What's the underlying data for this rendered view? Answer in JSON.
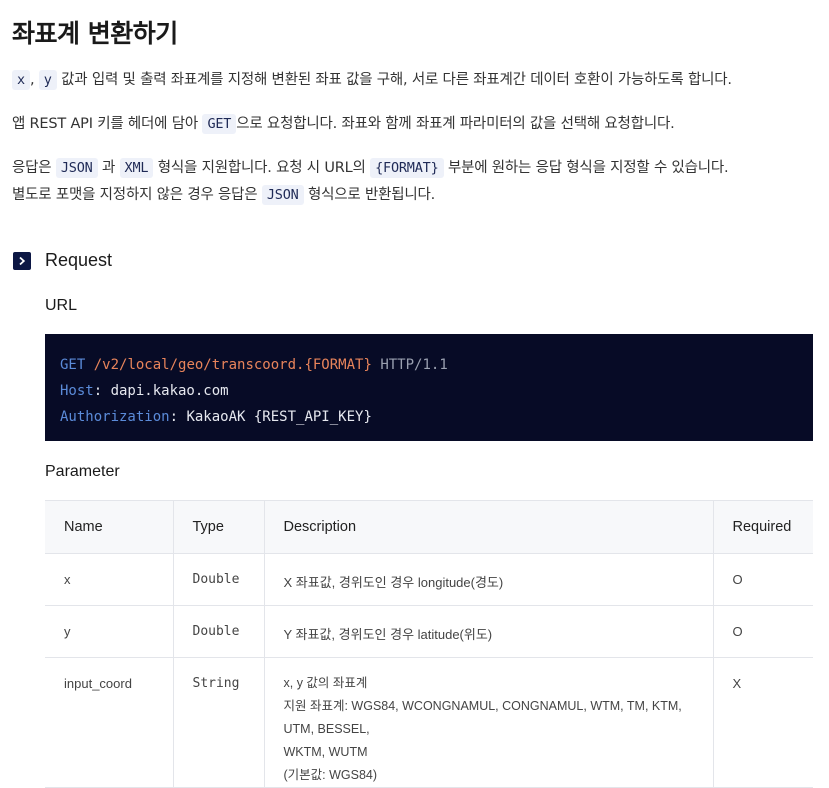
{
  "title": "좌표계 변환하기",
  "intro": {
    "x_code": "x",
    "comma": ",",
    "y_code": "y",
    "text": "값과 입력 및 출력 좌표계를 지정해 변환된 좌표 값을 구해, 서로 다른 좌표계간 데이터 호환이 가능하도록 합니다."
  },
  "auth": {
    "prefix": "앱 REST API 키를 헤더에 담아",
    "method_code": "GET",
    "suffix": "으로 요청합니다. 좌표와 함께 좌표계 파라미터의 값을 선택해 요청합니다."
  },
  "response": {
    "prefix": "응답은",
    "json_code": "JSON",
    "and": "과",
    "xml_code": "XML",
    "mid": "형식을 지원합니다. 요청 시 URL의",
    "format_code": "{FORMAT}",
    "suffix": "부분에 원하는 응답 형식을 지정할 수 있습니다.",
    "line2_prefix": "별도로 포맷을 지정하지 않은 경우 응답은",
    "json_code2": "JSON",
    "line2_suffix": "형식으로 반환됩니다."
  },
  "request": {
    "heading": "Request",
    "url_heading": "URL",
    "code": {
      "method": "GET",
      "path": "/v2/local/geo/transcoord.",
      "format": "{FORMAT}",
      "protocol": "HTTP/1.1",
      "host_key": "Host",
      "host_value": "dapi.kakao.com",
      "auth_key": "Authorization",
      "auth_value": "KakaoAK {REST_API_KEY}"
    },
    "param_heading": "Parameter",
    "columns": [
      "Name",
      "Type",
      "Description",
      "Required"
    ],
    "rows": [
      {
        "name": "x",
        "type": "Double",
        "description": [
          "X 좌표값, 경위도인 경우 longitude(경도)"
        ],
        "required": "O"
      },
      {
        "name": "y",
        "type": "Double",
        "description": [
          "Y 좌표값, 경위도인 경우 latitude(위도)"
        ],
        "required": "O"
      },
      {
        "name": "input_coord",
        "type": "String",
        "description": [
          "x, y 값의 좌표계",
          "지원 좌표계: WGS84, WCONGNAMUL, CONGNAMUL, WTM, TM, KTM, UTM, BESSEL,",
          "WKTM, WUTM",
          "(기본값: WGS84)"
        ],
        "required": "X"
      }
    ]
  },
  "colors": {
    "code_bg": "#070b26",
    "keyword": "#5b8bd9",
    "path": "#e8845b",
    "inline_code_bg": "#eef1f9",
    "chevron_bg": "#0c1744"
  },
  "icons": {
    "section_marker": "chevron-right-icon"
  }
}
